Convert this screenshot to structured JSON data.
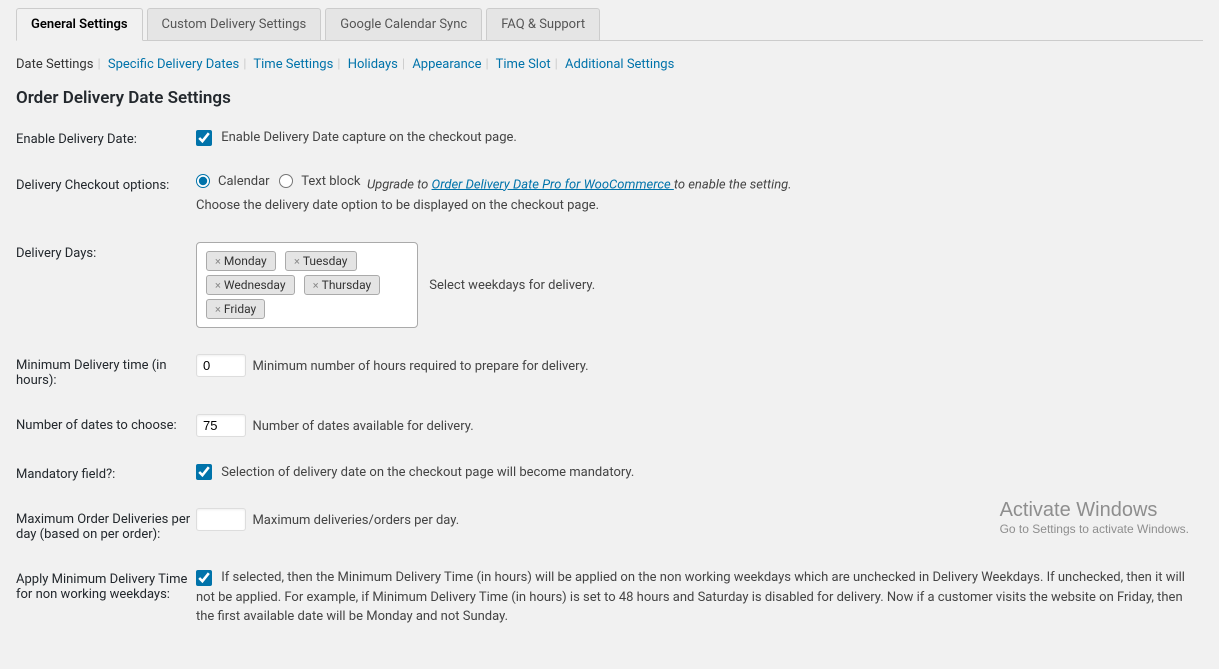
{
  "tabs": {
    "t0": "General Settings",
    "t1": "Custom Delivery Settings",
    "t2": "Google Calendar Sync",
    "t3": "FAQ & Support"
  },
  "subnav": {
    "s0": "Date Settings",
    "s1": "Specific Delivery Dates",
    "s2": "Time Settings",
    "s3": "Holidays",
    "s4": "Appearance",
    "s5": "Time Slot",
    "s6": "Additional Settings"
  },
  "page_title": "Order Delivery Date Settings",
  "fields": {
    "enable_date": {
      "label": "Enable Delivery Date:",
      "desc": "Enable Delivery Date capture on the checkout page."
    },
    "checkout": {
      "label": "Delivery Checkout options:",
      "opt_calendar": "Calendar",
      "opt_textblock": "Text block",
      "upgrade_prefix": "Upgrade to ",
      "upgrade_link": "Order Delivery Date Pro for WooCommerce ",
      "upgrade_suffix": "to enable the setting.",
      "desc": "Choose the delivery date option to be displayed on the checkout page."
    },
    "days": {
      "label": "Delivery Days:",
      "tags": [
        "Monday",
        "Tuesday",
        "Wednesday",
        "Thursday",
        "Friday"
      ],
      "desc": "Select weekdays for delivery."
    },
    "min_time": {
      "label": "Minimum Delivery time (in hours):",
      "value": "0",
      "desc": "Minimum number of hours required to prepare for delivery."
    },
    "num_dates": {
      "label": "Number of dates to choose:",
      "value": "75",
      "desc": "Number of dates available for delivery."
    },
    "mandatory": {
      "label": "Mandatory field?:",
      "desc": "Selection of delivery date on the checkout page will become mandatory."
    },
    "max_orders": {
      "label": "Maximum Order Deliveries per day (based on per order):",
      "value": "",
      "desc": "Maximum deliveries/orders per day."
    },
    "apply_min": {
      "label": "Apply Minimum Delivery Time for non working weekdays:",
      "desc": "If selected, then the Minimum Delivery Time (in hours) will be applied on the non working weekdays which are unchecked in Delivery Weekdays. If unchecked, then it will not be applied. For example, if Minimum Delivery Time (in hours) is set to 48 hours and Saturday is disabled for delivery. Now if a customer visits the website on Friday, then the first available date will be Monday and not Sunday."
    }
  },
  "watermark": {
    "l1": "Activate Windows",
    "l2": "Go to Settings to activate Windows."
  }
}
